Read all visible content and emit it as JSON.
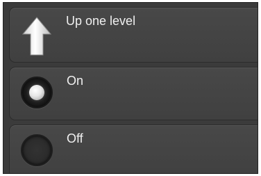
{
  "menu": {
    "items": [
      {
        "label": "Up one level",
        "icon": "up-arrow-icon"
      },
      {
        "label": "On",
        "icon": "radio-selected-icon",
        "selected": true
      },
      {
        "label": "Off",
        "icon": "radio-unselected-icon",
        "selected": false
      }
    ]
  }
}
